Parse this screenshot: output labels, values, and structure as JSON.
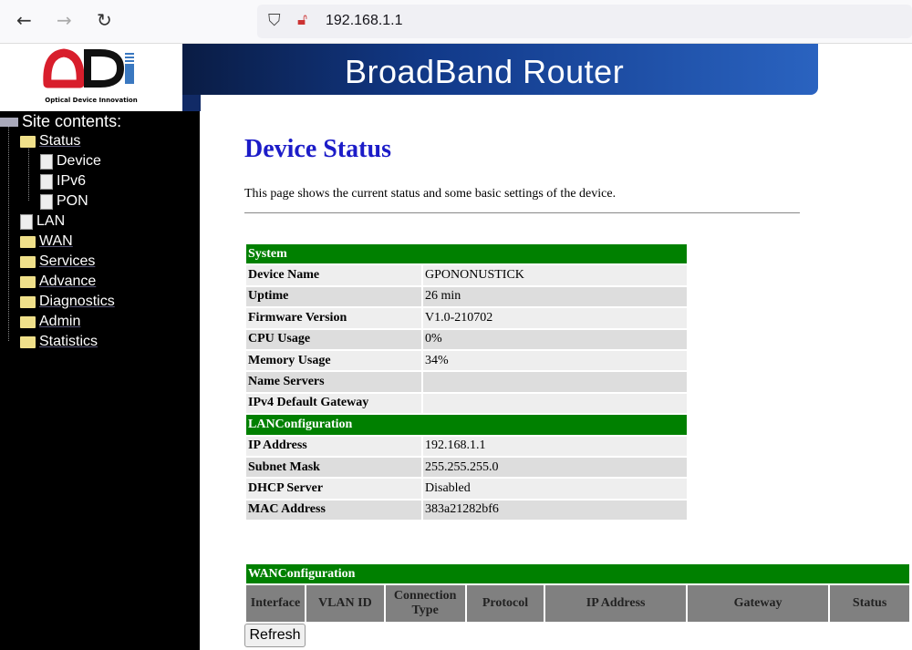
{
  "browser": {
    "url": "192.168.1.1"
  },
  "header": {
    "logo_text": "ODI",
    "logo_tagline": "Optical Device Innovation",
    "banner_title": "BroadBand Router"
  },
  "sidebar": {
    "title": "Site contents:",
    "items": [
      {
        "label": "Status",
        "icon": "folder-open-icon",
        "level": 1
      },
      {
        "label": "Device",
        "icon": "document-icon",
        "level": 2
      },
      {
        "label": "IPv6",
        "icon": "document-icon",
        "level": 2
      },
      {
        "label": "PON",
        "icon": "document-icon",
        "level": 2
      },
      {
        "label": "LAN",
        "icon": "document-icon",
        "level": 1
      },
      {
        "label": "WAN",
        "icon": "folder-icon",
        "level": 1
      },
      {
        "label": "Services",
        "icon": "folder-icon",
        "level": 1
      },
      {
        "label": "Advance",
        "icon": "folder-icon",
        "level": 1
      },
      {
        "label": "Diagnostics",
        "icon": "folder-icon",
        "level": 1
      },
      {
        "label": "Admin",
        "icon": "folder-icon",
        "level": 1
      },
      {
        "label": "Statistics",
        "icon": "folder-icon",
        "level": 1
      }
    ]
  },
  "page": {
    "title": "Device Status",
    "description": "This page shows the current status and some basic settings of the device."
  },
  "system": {
    "header": "System",
    "rows": [
      [
        "Device Name",
        "GPONONUSTICK"
      ],
      [
        "Uptime",
        "26 min"
      ],
      [
        "Firmware Version",
        "V1.0-210702"
      ],
      [
        "CPU Usage",
        "0%"
      ],
      [
        "Memory Usage",
        "34%"
      ],
      [
        "Name Servers",
        ""
      ],
      [
        "IPv4 Default Gateway",
        ""
      ]
    ]
  },
  "lan": {
    "header": "LANConfiguration",
    "rows": [
      [
        "IP Address",
        "192.168.1.1"
      ],
      [
        "Subnet Mask",
        "255.255.255.0"
      ],
      [
        "DHCP Server",
        "Disabled"
      ],
      [
        "MAC Address",
        "383a21282bf6"
      ]
    ]
  },
  "wan": {
    "header": "WANConfiguration",
    "columns": [
      "Interface",
      "VLAN ID",
      "Connection Type",
      "Protocol",
      "IP Address",
      "Gateway",
      "Status"
    ]
  },
  "buttons": {
    "refresh": "Refresh"
  },
  "colors": {
    "section_header": "#008000",
    "title": "#1c1cc8",
    "sidebar_bg": "#000000"
  }
}
